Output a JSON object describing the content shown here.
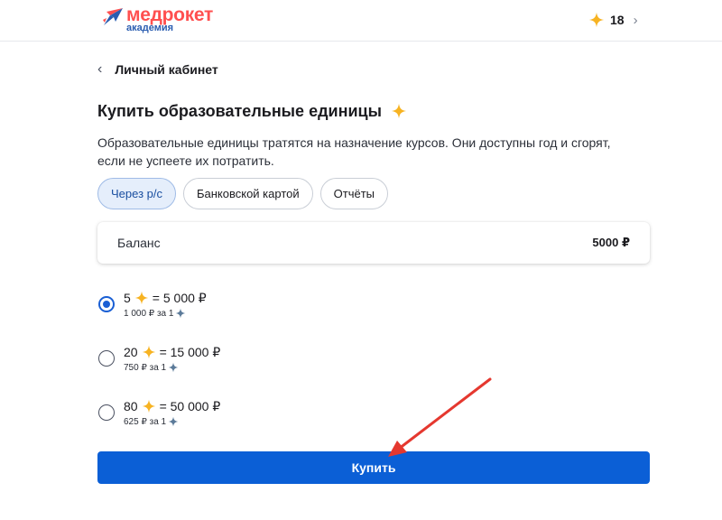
{
  "header": {
    "logo_main": "медрокет",
    "logo_sub": "академия",
    "balance_count": "18",
    "chevron": "›"
  },
  "nav": {
    "back_icon": "‹",
    "back_label": "Личный кабинет"
  },
  "page": {
    "title": "Купить образовательные единицы",
    "description": "Образовательные единицы тратятся на назначение курсов. Они доступны год и сгорят, если не успеете их потратить."
  },
  "tabs": [
    {
      "label": "Через р/с",
      "active": true
    },
    {
      "label": "Банковской картой",
      "active": false
    },
    {
      "label": "Отчёты",
      "active": false
    }
  ],
  "balance_card": {
    "label": "Баланс",
    "value": "5000 ₽"
  },
  "options": [
    {
      "qty": "5",
      "price": "= 5 000 ₽",
      "unit_price": "1 000 ₽ за 1",
      "selected": true
    },
    {
      "qty": "20",
      "price": "= 15 000 ₽",
      "unit_price": "750 ₽ за 1",
      "selected": false
    },
    {
      "qty": "80",
      "price": "= 50 000 ₽",
      "unit_price": "625 ₽ за 1",
      "selected": false
    }
  ],
  "buy_button": {
    "label": "Купить"
  },
  "icons": {
    "star": "sparkle-star-icon",
    "small_star": "small-sparkle-icon",
    "logo": "rocket-logo-icon",
    "annotation": "red-arrow-annotation"
  },
  "colors": {
    "accent": "#0b5fd6",
    "star": "#f7b322",
    "small_star": "#5b7a99",
    "brand_red": "#ff4f4f",
    "brand_blue": "#2a5db0",
    "annotation": "#e5382f"
  }
}
